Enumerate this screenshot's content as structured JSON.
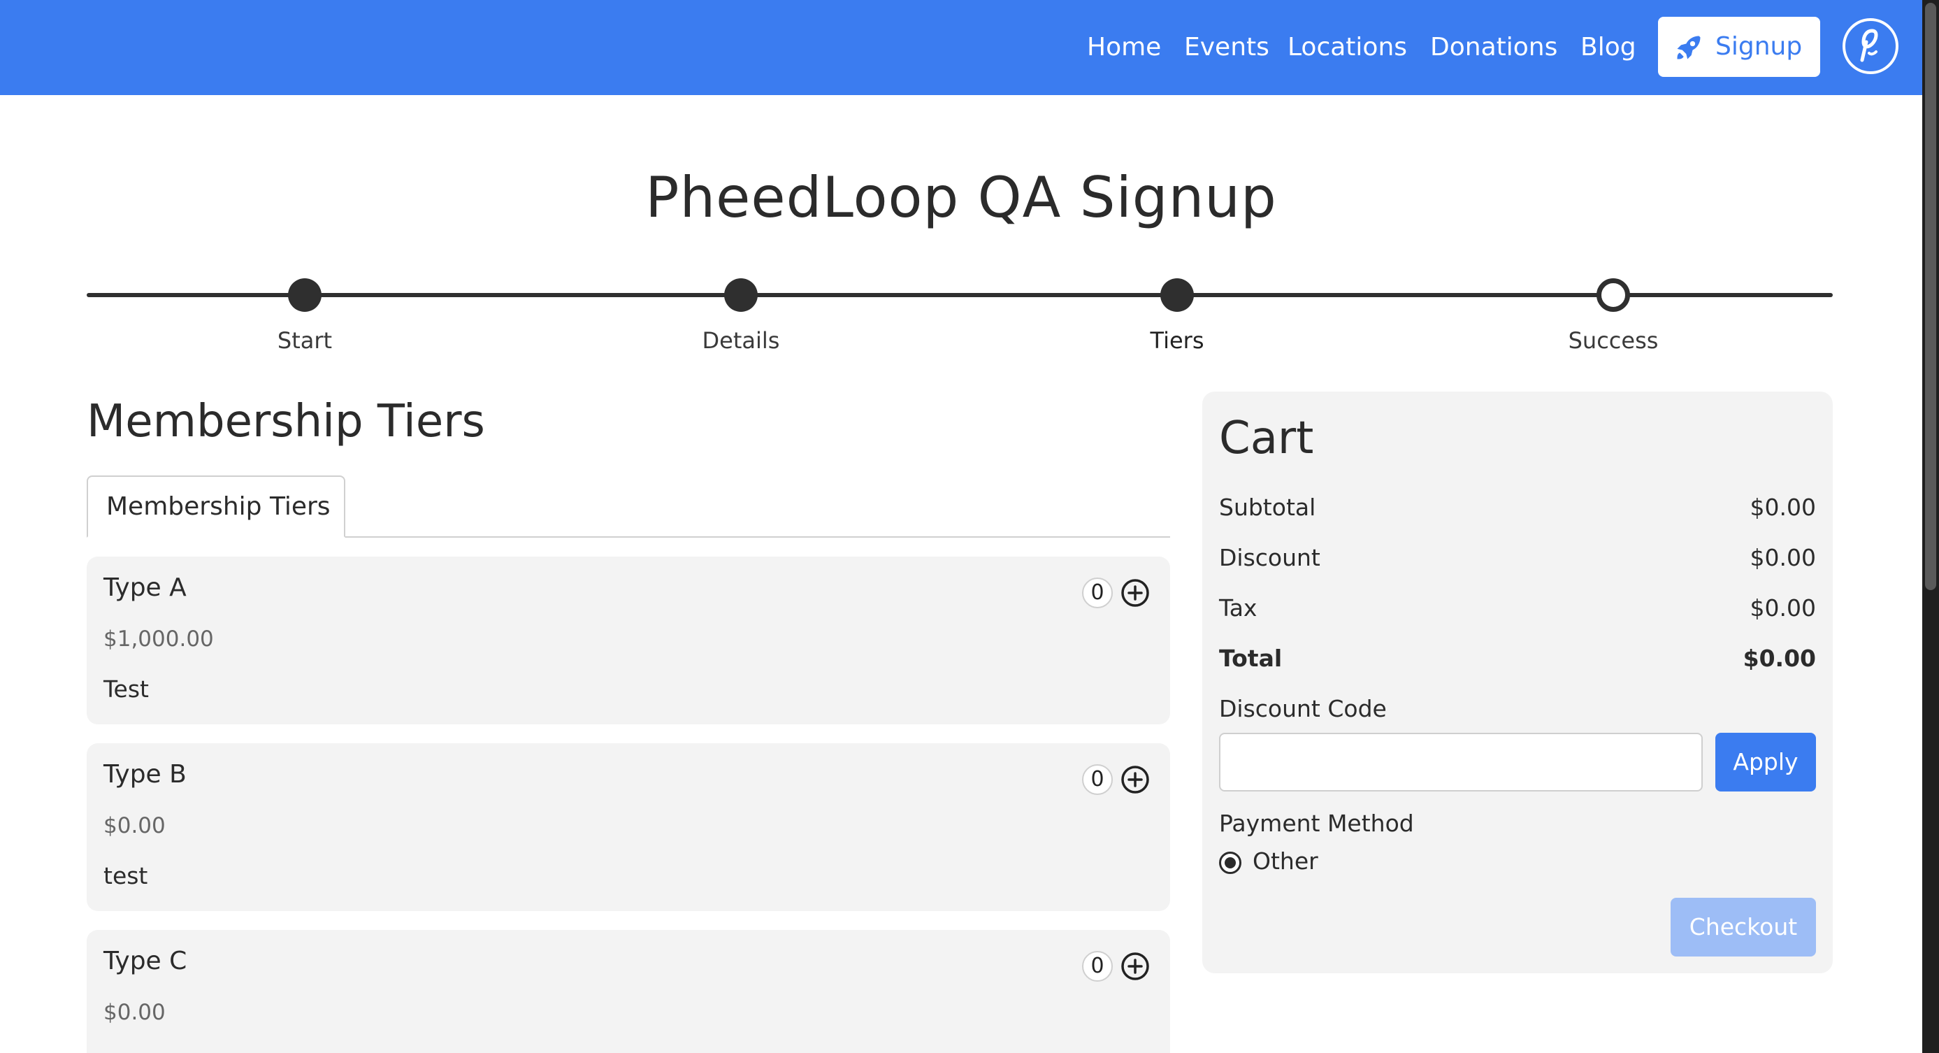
{
  "nav": {
    "links": [
      "Home",
      "Events",
      "Locations",
      "Donations",
      "Blog"
    ],
    "signup_label": "Signup"
  },
  "page": {
    "title": "PheedLoop QA Signup"
  },
  "stepper": {
    "steps": [
      {
        "label": "Start",
        "state": "complete"
      },
      {
        "label": "Details",
        "state": "complete"
      },
      {
        "label": "Tiers",
        "state": "current"
      },
      {
        "label": "Success",
        "state": "pending"
      }
    ]
  },
  "tiers": {
    "heading": "Membership Tiers",
    "tab_label": "Membership Tiers",
    "items": [
      {
        "name": "Type A",
        "price": "$1,000.00",
        "description": "Test",
        "quantity": "0"
      },
      {
        "name": "Type B",
        "price": "$0.00",
        "description": "test",
        "quantity": "0"
      },
      {
        "name": "Type C",
        "price": "$0.00",
        "description": "",
        "quantity": "0"
      }
    ]
  },
  "cart": {
    "title": "Cart",
    "rows": [
      {
        "label": "Subtotal",
        "value": "$0.00"
      },
      {
        "label": "Discount",
        "value": "$0.00"
      },
      {
        "label": "Tax",
        "value": "$0.00"
      },
      {
        "label": "Total",
        "value": "$0.00"
      }
    ],
    "discount_label": "Discount Code",
    "discount_value": "",
    "apply_label": "Apply",
    "payment_label": "Payment Method",
    "payment_option": "Other",
    "checkout_label": "Checkout"
  },
  "colors": {
    "brand": "#3b7cf0",
    "checkout_disabled": "#9dbdf6",
    "card_bg": "#f3f3f3"
  },
  "icons": {
    "signup": "rocket-icon",
    "logo": "pheedloop-logo-icon",
    "add": "plus-circle-icon"
  }
}
